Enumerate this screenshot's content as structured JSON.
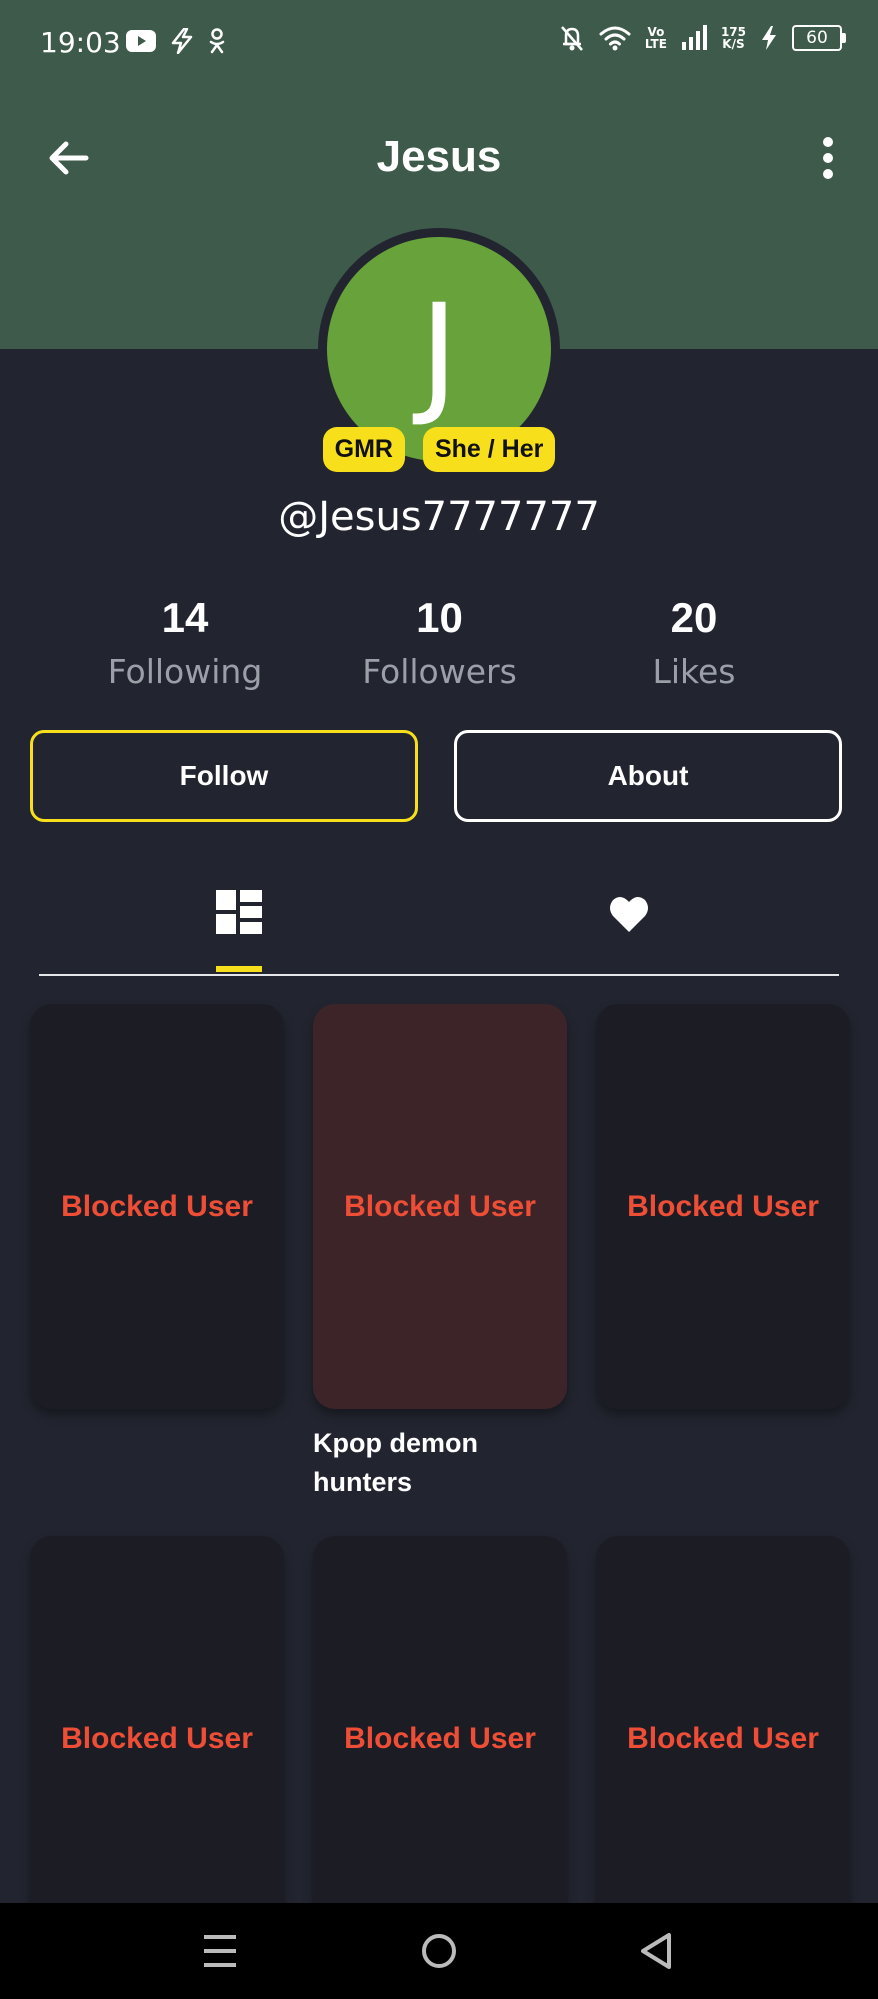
{
  "status_bar": {
    "time": "19:03",
    "left_icons": [
      "youtube-icon",
      "flash-icon",
      "odnoklassniki-icon"
    ],
    "right_icons": [
      "muted-bell-icon",
      "wifi-icon",
      "volte-icon",
      "signal-icon",
      "speed-icon",
      "charging-icon",
      "battery-icon"
    ],
    "volte_top": "Vo",
    "volte_bottom": "LTE",
    "speed_top": "175",
    "speed_bottom": "K/S",
    "battery": "60"
  },
  "app_bar": {
    "title": "Jesus",
    "back_icon": "arrow-left-icon",
    "menu_icon": "more-vertical-icon"
  },
  "profile": {
    "avatar_letter": "J",
    "avatar_color": "#67a33a",
    "badges": [
      "GMR",
      "She / Her"
    ],
    "username": "@Jesus7777777"
  },
  "stats": [
    {
      "value": "14",
      "label": "Following"
    },
    {
      "value": "10",
      "label": "Followers"
    },
    {
      "value": "20",
      "label": "Likes"
    }
  ],
  "actions": {
    "follow": "Follow",
    "about": "About"
  },
  "tabs": [
    {
      "icon": "dashboard-grid-icon",
      "active": true
    },
    {
      "icon": "heart-icon",
      "active": false
    }
  ],
  "posts": [
    {
      "label": "Blocked User"
    },
    {
      "label": "Blocked User",
      "caption": "Kpop demon hunters"
    },
    {
      "label": "Blocked User"
    },
    {
      "label": "Blocked User"
    },
    {
      "label": "Blocked User"
    },
    {
      "label": "Blocked User"
    }
  ],
  "nav_bar": {
    "icons": [
      "menu-icon",
      "home-circle-icon",
      "back-triangle-icon"
    ]
  },
  "colors": {
    "header": "#3d5a4b",
    "background": "#22252f",
    "accent": "#f7e01b",
    "blocked_text": "#ee4e36"
  }
}
